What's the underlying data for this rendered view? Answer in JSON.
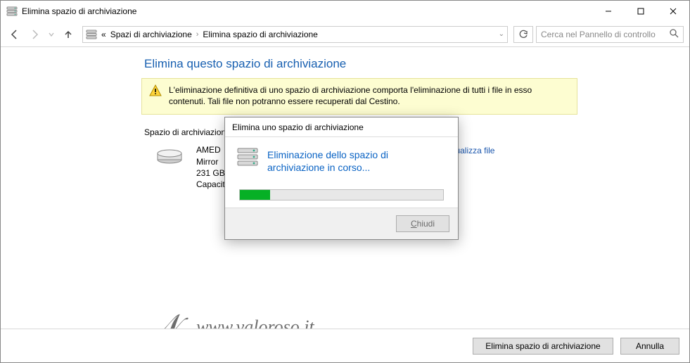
{
  "window": {
    "title": "Elimina spazio di archiviazione"
  },
  "nav": {
    "crumb_prefix": "«",
    "crumb1": "Spazi di archiviazione",
    "crumb2": "Elimina spazio di archiviazione",
    "search_placeholder": "Cerca nel Pannello di controllo"
  },
  "content": {
    "heading": "Elimina questo spazio di archiviazione",
    "warning": "L'eliminazione definitiva di uno spazio di archiviazione comporta l'eliminazione di tutti i file in esso contenuti. Tali file non potranno essere recuperati dal Cestino.",
    "subhead": "Spazio di archiviazione",
    "drive_name": "AMED",
    "drive_type": "Mirror",
    "drive_size": "231 GB",
    "drive_cap": "Capacity",
    "view_link": "Visualizza file"
  },
  "dialog": {
    "title": "Elimina uno spazio di archiviazione",
    "message": "Eliminazione dello spazio di archiviazione in corso...",
    "close": "Chiudi",
    "progress_percent": 15
  },
  "footer": {
    "primary": "Elimina spazio di archiviazione",
    "cancel": "Annulla"
  },
  "watermark": {
    "text": "www.valoroso.it"
  }
}
